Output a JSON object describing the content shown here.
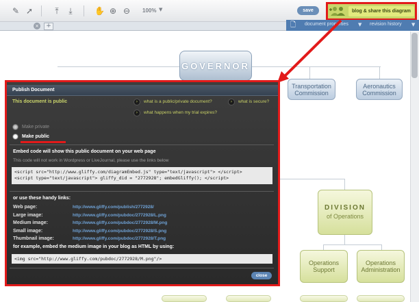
{
  "toolbar": {
    "zoom": "100%",
    "save_label": "save",
    "share_label": "blog & share this diagram"
  },
  "tabbar": {
    "document_properties": "document properties",
    "revision_history": "revision history"
  },
  "canvas": {
    "governor": "GOVERNOR",
    "transportation": [
      "Transportation",
      "Commission"
    ],
    "aeronautics": [
      "Aeronautics",
      "Commission"
    ],
    "division_title": "DIVISION",
    "division_sub": "of Operations",
    "division_faded": "DIVISION",
    "ops_support": [
      "Operations",
      "Support"
    ],
    "ops_admin": [
      "Operations",
      "Administration"
    ]
  },
  "dialog": {
    "title": "Publish Document",
    "status": "This document is public",
    "questions": [
      "what is a public/private document?",
      "what is secure?",
      "what happens when my trial expires?"
    ],
    "make_private": "Make private",
    "make_public": "Make public",
    "embed_heading": "Embed code will show this public document on your web page",
    "embed_note": "This code will not work in Wordpress or LiveJournal, please use the links below",
    "embed_code": "<script src=\"http://www.gliffy.com/diagramEmbed.js\" type=\"text/javascript\"> </script>\n<script type=\"text/javascript\"> gliffy_did = \"2772928\"; embedGliffy(); </script>",
    "links_heading": "or use these handy links:",
    "links": [
      {
        "label": "Web page:",
        "url": "http://www.gliffy.com/publish/2772928/"
      },
      {
        "label": "Large image:",
        "url": "http://www.gliffy.com/pubdoc/2772928/L.png"
      },
      {
        "label": "Medium image:",
        "url": "http://www.gliffy.com/pubdoc/2772928/M.png"
      },
      {
        "label": "Small image:",
        "url": "http://www.gliffy.com/pubdoc/2772928/S.png"
      },
      {
        "label": "Thumbnail image:",
        "url": "http://www.gliffy.com/pubdoc/2772928/T.png"
      }
    ],
    "example_heading": "for example, embed the medium image in your blog as HTML by using:",
    "example_code": "<img src=\"http://www.gliffy.com/pubdoc/2772928/M.png\"/>",
    "close_label": "close"
  }
}
